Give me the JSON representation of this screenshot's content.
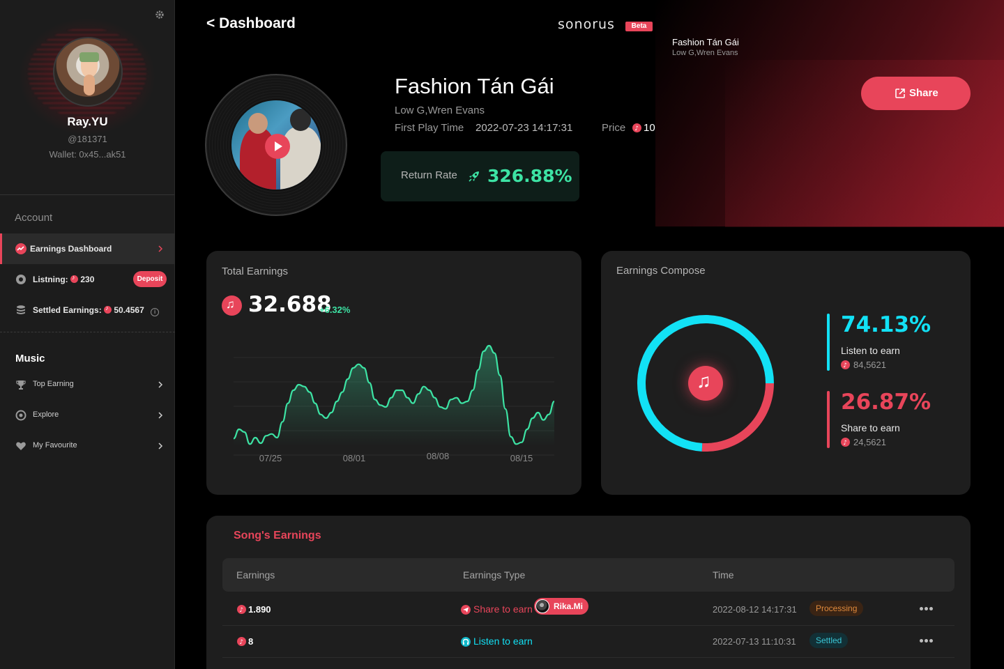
{
  "sidebar": {
    "profile": {
      "name": "Ray.YU",
      "handle": "@181371",
      "wallet": "Wallet: 0x45...ak51"
    },
    "account_title": "Account",
    "items": [
      {
        "label": "Earnings Dashboard",
        "icon": "trend-icon",
        "active": true
      },
      {
        "label": "Listning:",
        "value": "230",
        "icon": "disc-icon",
        "action": "Deposit"
      },
      {
        "label": "Settled Earnings:",
        "value": "50.4567",
        "icon": "database-icon"
      }
    ],
    "music_title": "Music",
    "music_items": [
      {
        "label": "Top Earning",
        "icon": "trophy-icon"
      },
      {
        "label": "Explore",
        "icon": "compass-icon"
      },
      {
        "label": "My Favourite",
        "icon": "heart-icon"
      }
    ]
  },
  "header": {
    "back_label": "< Dashboard",
    "brand": "sonorus",
    "badge": "Beta",
    "now_playing": {
      "title": "Fashion Tán Gái",
      "artist": "Low G,Wren Evans"
    }
  },
  "song": {
    "title": "Fashion Tán Gái",
    "artist": "Low G,Wren Evans",
    "first_play_label": "First Play Time",
    "first_play_value": "2022-07-23 14:17:31",
    "price_label": "Price",
    "price_value": "10",
    "return_rate_label": "Return Rate",
    "return_rate_value": "326.88%",
    "share_label": "Share"
  },
  "total_earnings": {
    "title": "Total Earnings",
    "value": "32.688",
    "delta": "+6.32%"
  },
  "chart_data": {
    "type": "area",
    "x_ticks": [
      "07/25",
      "08/01",
      "08/08",
      "08/15"
    ],
    "values": [
      0.4,
      0.9,
      0.75,
      0.1,
      0.45,
      0.15,
      0.55,
      0.65,
      0.45,
      1.3,
      2.3,
      3.0,
      3.3,
      3.2,
      2.9,
      2.3,
      1.7,
      1.5,
      1.8,
      2.4,
      2.9,
      3.6,
      4.2,
      4.4,
      4.2,
      3.4,
      2.5,
      2.2,
      2.1,
      2.6,
      3.0,
      3.0,
      2.6,
      2.3,
      2.8,
      3.2,
      3.0,
      2.6,
      2.1,
      2.0,
      2.5,
      2.6,
      2.3,
      2.4,
      3.0,
      4.1,
      5.1,
      5.4,
      5.0,
      3.8,
      2.0,
      0.5,
      0.1,
      0.2,
      0.9,
      1.5,
      1.8,
      1.4,
      1.7,
      2.4
    ],
    "ylim": [
      0,
      6
    ],
    "grid": true,
    "color": "#3de3a4"
  },
  "earnings_compose": {
    "title": "Earnings Compose",
    "items": [
      {
        "percent": "74.13%",
        "label": "Listen to earn",
        "value": "84,5621",
        "color": "#12e1f5",
        "fraction": 0.7413
      },
      {
        "percent": "26.87%",
        "label": "Share to earn",
        "value": "24,5621",
        "color": "#e8455a",
        "fraction": 0.2687
      }
    ]
  },
  "song_earnings": {
    "title": "Song's Earnings",
    "columns": [
      "Earnings",
      "Earnings Type",
      "Time"
    ],
    "rows": [
      {
        "amount": "1.890",
        "type": "Share to earn",
        "type_color": "#e8455a",
        "user": "Rika.Mi",
        "time": "2022-08-12 14:17:31",
        "status": "Processing"
      },
      {
        "amount": "8",
        "type": "Listen to earn",
        "type_color": "#12e1f5",
        "user": "",
        "time": "2022-07-13 11:10:31",
        "status": "Settled"
      }
    ]
  },
  "colors": {
    "accent": "#e8455a",
    "green": "#3de3a4",
    "cyan": "#12e1f5",
    "bg": "#000000",
    "card": "#1e1e1e"
  }
}
